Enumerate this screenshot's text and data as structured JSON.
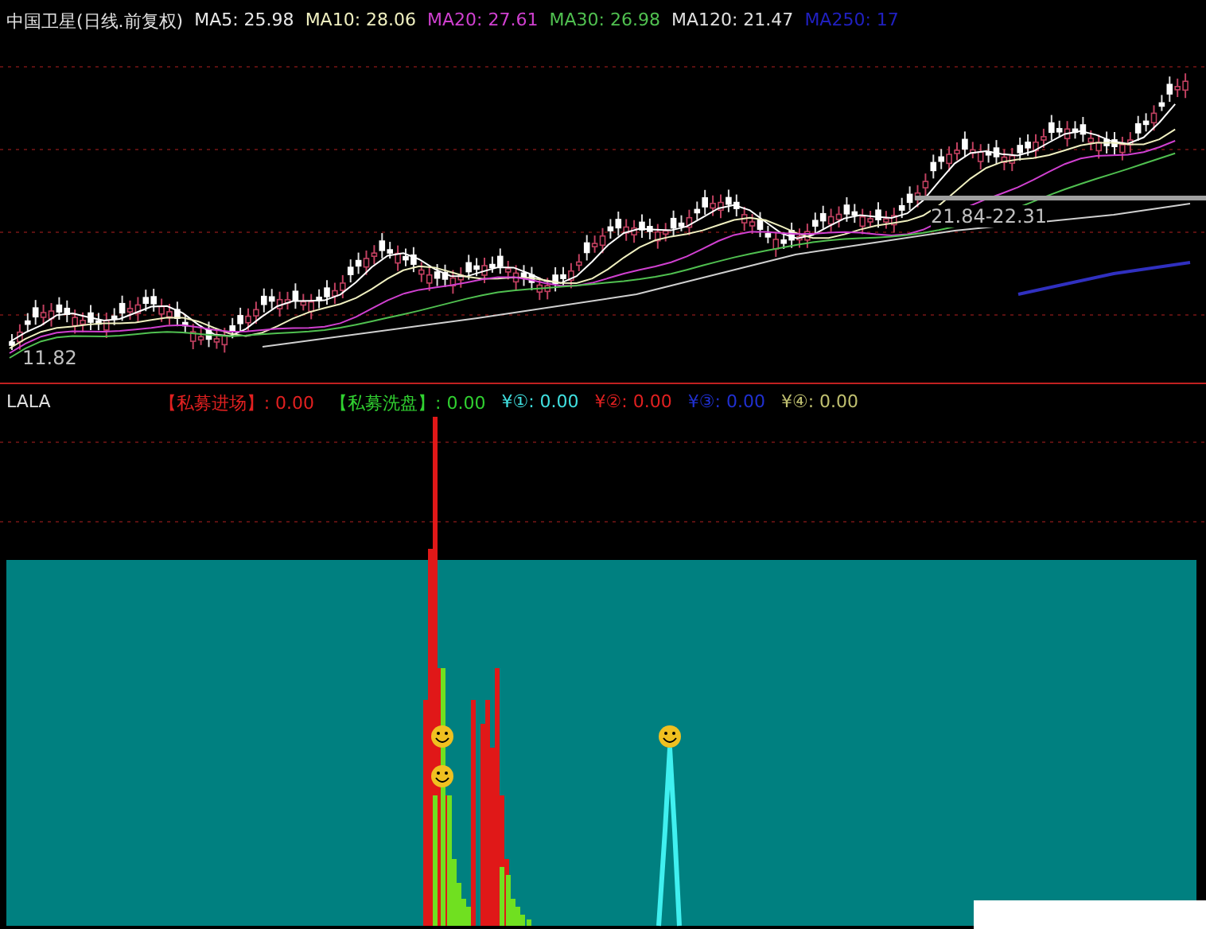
{
  "price_panel": {
    "title": "中国卫星(日线.前复权)",
    "moving_averages": [
      {
        "label": "MA5: 25.98",
        "color": "#e8e8e8"
      },
      {
        "label": "MA10: 28.06",
        "color": "#f0f0c0"
      },
      {
        "label": "MA20: 27.61",
        "color": "#d040d0"
      },
      {
        "label": "MA30: 26.98",
        "color": "#50c050"
      },
      {
        "label": "MA120: 21.47",
        "color": "#e0e0e0"
      },
      {
        "label": "MA250: 17",
        "color": "#2020c0"
      }
    ],
    "low_label": "11.82",
    "range_label": "21.84-22.31"
  },
  "indicator_panel": {
    "title": "LALA",
    "readings": [
      {
        "label": "【私募进场】",
        "value": ": 0.00",
        "color": "#e02020"
      },
      {
        "label": "【私募洗盘】",
        "value": ": 0.00",
        "color": "#30d030"
      },
      {
        "label": "¥①",
        "value": ": 0.00",
        "color": "#40e0e0"
      },
      {
        "label": "¥②",
        "value": ": 0.00",
        "color": "#e02020"
      },
      {
        "label": "¥③",
        "value": ": 0.00",
        "color": "#2030d0"
      },
      {
        "label": "¥④",
        "value": ": 0.00",
        "color": "#c0c070"
      }
    ]
  }
}
